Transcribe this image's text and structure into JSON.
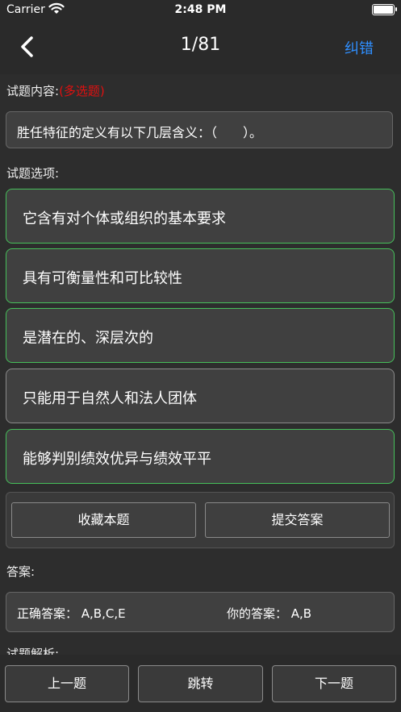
{
  "status_bar": {
    "carrier": "Carrier",
    "time": "2:48 PM"
  },
  "nav": {
    "title": "1/81",
    "correct_label": "纠错"
  },
  "question": {
    "label": "试题内容:",
    "type_tag": "(多选题)",
    "text": "胜任特征的定义有以下几层含义：（　　）。"
  },
  "options_label": "试题选项:",
  "options": [
    {
      "text": "它含有对个体或组织的基本要求",
      "state": "green"
    },
    {
      "text": "具有可衡量性和可比较性",
      "state": "green"
    },
    {
      "text": "是潜在的、深层次的",
      "state": "green"
    },
    {
      "text": "只能用于自然人和法人团体",
      "state": "gray"
    },
    {
      "text": "能够判别绩效优异与绩效平平",
      "state": "green"
    }
  ],
  "actions": {
    "favorite": "收藏本题",
    "submit": "提交答案"
  },
  "answer": {
    "label": "答案:",
    "correct_text": "正确答案：  A,B,C,E",
    "yours_text": "你的答案：  A,B"
  },
  "analysis_label": "试题解析:",
  "bottom": {
    "prev": "上一题",
    "jump": "跳转",
    "next": "下一题"
  },
  "colors": {
    "accent": "#2f8fff",
    "tag": "#e01010",
    "correct_border": "#46c05a"
  }
}
